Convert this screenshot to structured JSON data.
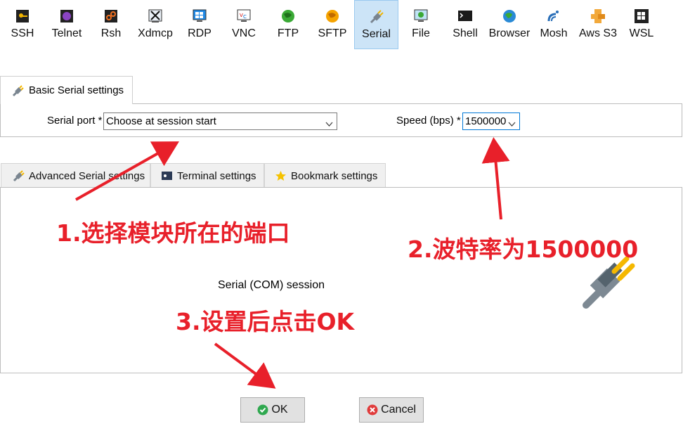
{
  "toolbar": {
    "items": [
      {
        "label": "SSH",
        "icon": "ssh-key-icon"
      },
      {
        "label": "Telnet",
        "icon": "telnet-icon"
      },
      {
        "label": "Rsh",
        "icon": "rsh-icon"
      },
      {
        "label": "Xdmcp",
        "icon": "xdmcp-icon"
      },
      {
        "label": "RDP",
        "icon": "rdp-icon"
      },
      {
        "label": "VNC",
        "icon": "vnc-icon"
      },
      {
        "label": "FTP",
        "icon": "ftp-globe-icon"
      },
      {
        "label": "SFTP",
        "icon": "sftp-globe-icon"
      },
      {
        "label": "Serial",
        "icon": "serial-plug-icon",
        "active": true
      },
      {
        "label": "File",
        "icon": "file-monitor-icon"
      },
      {
        "label": "Shell",
        "icon": "shell-terminal-icon"
      },
      {
        "label": "Browser",
        "icon": "browser-globe-icon"
      },
      {
        "label": "Mosh",
        "icon": "mosh-satellite-icon"
      },
      {
        "label": "Aws S3",
        "icon": "aws-s3-icon"
      },
      {
        "label": "WSL",
        "icon": "wsl-windows-icon"
      }
    ]
  },
  "basic": {
    "tab_label": "Basic Serial settings",
    "serial_port_label": "Serial port *",
    "serial_port_value": "Choose at session start",
    "speed_label": "Speed (bps) *",
    "speed_value": "1500000"
  },
  "lower_tabs": {
    "advanced": "Advanced Serial settings",
    "terminal": "Terminal settings",
    "bookmark": "Bookmark settings"
  },
  "session_label": "Serial (COM) session",
  "buttons": {
    "ok": "OK",
    "cancel": "Cancel"
  },
  "annotations": {
    "step1": "1.选择模块所在的端口",
    "step2": "2.波特率为1500000",
    "step3": "3.设置后点击OK"
  },
  "colors": {
    "annotation": "#e8202a",
    "active_tab": "#cce4f7",
    "ok_icon": "#2fa84f",
    "cancel_icon": "#e03b3b"
  }
}
